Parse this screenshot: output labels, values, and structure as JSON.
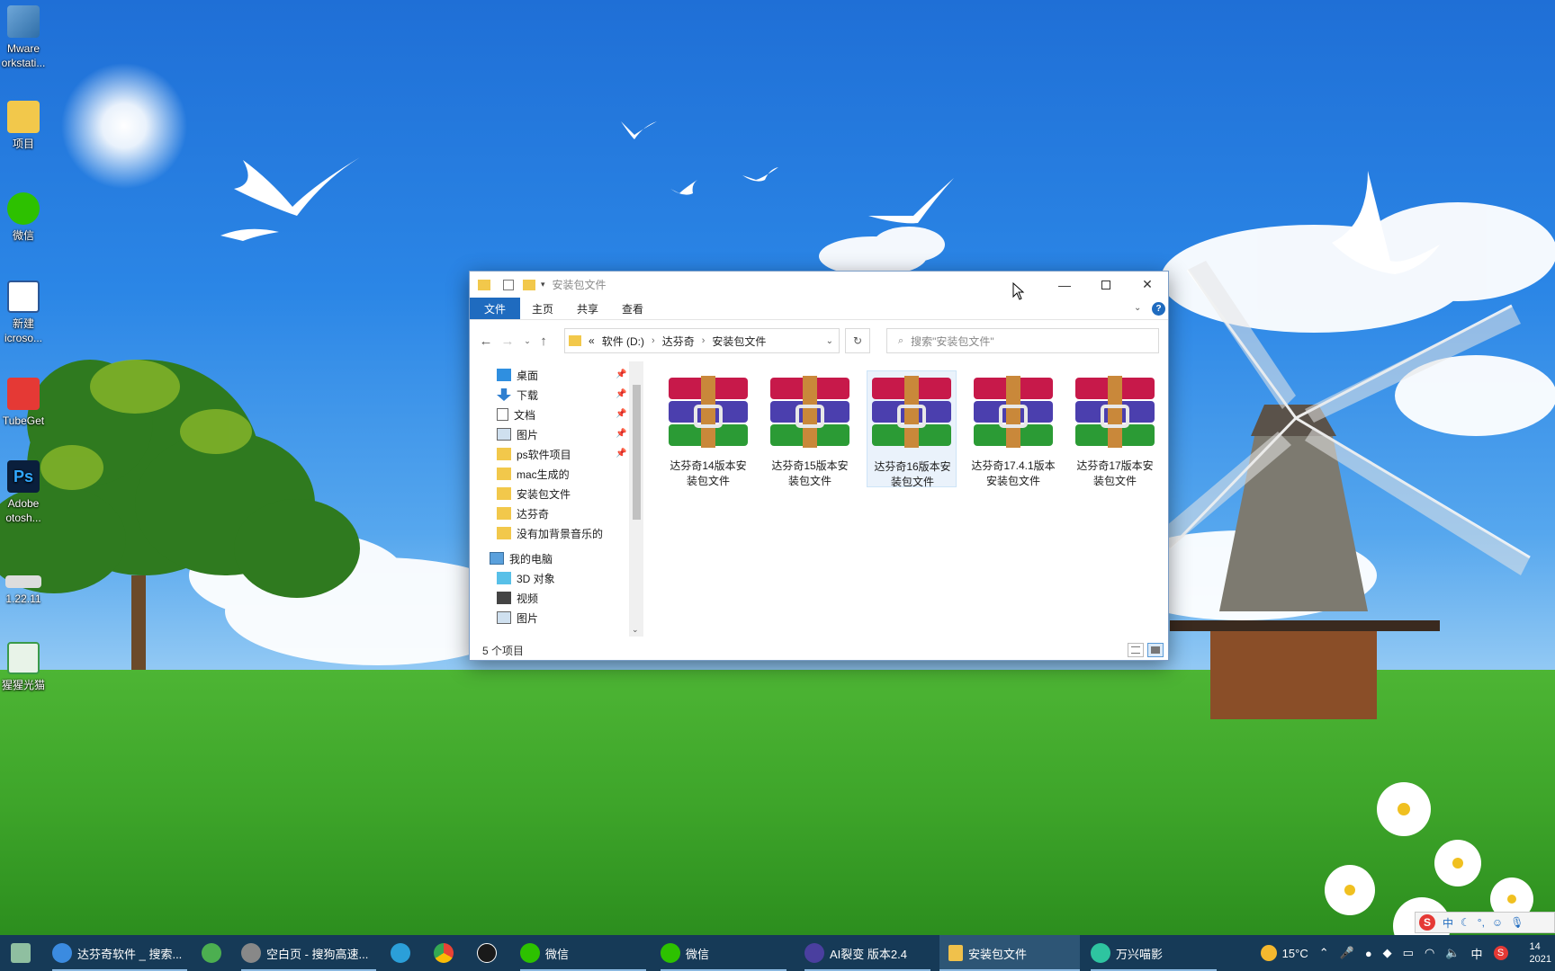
{
  "desktop": {
    "icons": [
      {
        "label": "Mware\norkstati...",
        "icon": "vmware-icon"
      },
      {
        "label": "项目",
        "icon": "folder-icon"
      },
      {
        "label": "微信",
        "icon": "wechat-icon"
      },
      {
        "label": "新建\nicroso...",
        "icon": "word-doc-icon"
      },
      {
        "label": "TubeGet",
        "icon": "tubeget-icon"
      },
      {
        "label": "Adobe\notosh...",
        "icon": "photoshop-icon"
      },
      {
        "label": "1.22.11",
        "icon": "app-icon"
      },
      {
        "label": "猩猩光猫",
        "icon": "app-icon"
      }
    ]
  },
  "explorer": {
    "title": "安装包文件",
    "ribbon_tabs": [
      "文件",
      "主页",
      "共享",
      "查看"
    ],
    "address": {
      "prefix": "«",
      "segments": [
        "软件 (D:)",
        "达芬奇",
        "安装包文件"
      ]
    },
    "search_placeholder": "搜索\"安装包文件\"",
    "nav": {
      "quick_access": [
        {
          "label": "桌面",
          "pinned": true,
          "icon": "desktop-icon"
        },
        {
          "label": "下载",
          "pinned": true,
          "icon": "download-icon"
        },
        {
          "label": "文档",
          "pinned": true,
          "icon": "documents-icon"
        },
        {
          "label": "图片",
          "pinned": true,
          "icon": "pictures-icon"
        },
        {
          "label": "ps软件项目",
          "pinned": true,
          "icon": "folder-icon"
        },
        {
          "label": "mac生成的",
          "pinned": false,
          "icon": "folder-icon"
        },
        {
          "label": "安装包文件",
          "pinned": false,
          "icon": "folder-icon"
        },
        {
          "label": "达芬奇",
          "pinned": false,
          "icon": "folder-icon"
        },
        {
          "label": "没有加背景音乐的",
          "pinned": false,
          "icon": "folder-icon"
        }
      ],
      "this_pc": {
        "label": "我的电脑",
        "icon": "computer-icon"
      },
      "pc_items": [
        {
          "label": "3D 对象",
          "icon": "3d-objects-icon"
        },
        {
          "label": "视频",
          "icon": "videos-icon"
        },
        {
          "label": "图片",
          "icon": "pictures-icon"
        }
      ]
    },
    "files": [
      {
        "name": "达芬奇14版本安装包文件",
        "selected": false
      },
      {
        "name": "达芬奇15版本安装包文件",
        "selected": false
      },
      {
        "name": "达芬奇16版本安装包文件",
        "selected": true
      },
      {
        "name": "达芬奇17.4.1版本安装包文件",
        "selected": false
      },
      {
        "name": "达芬奇17版本安装包文件",
        "selected": false
      }
    ],
    "status": "5 个项目"
  },
  "taskbar": {
    "items": [
      {
        "label": "达芬奇软件 _ 搜索...",
        "icon": "search-browser-icon",
        "color": "#3b8be0"
      },
      {
        "label": "",
        "icon": "app-green-icon",
        "color": "#4caf50"
      },
      {
        "label": "空白页 - 搜狗高速...",
        "icon": "sogou-browser-icon",
        "color": "#888888"
      },
      {
        "label": "",
        "icon": "edge-icon",
        "color": "#2b9fd9"
      },
      {
        "label": "",
        "icon": "chrome-icon",
        "color": "#e94335"
      },
      {
        "label": "",
        "icon": "dell-icon",
        "color": "#1a1a1a"
      },
      {
        "label": "微信",
        "icon": "wechat-icon",
        "color": "#2dc100"
      },
      {
        "label": "微信",
        "icon": "wechat-icon",
        "color": "#2dc100"
      },
      {
        "label": "AI裂变  版本2.4",
        "icon": "ai-app-icon",
        "color": "#4a3f9f"
      },
      {
        "label": "安装包文件",
        "icon": "folder-icon",
        "color": "#f0c14b"
      },
      {
        "label": "万兴喵影",
        "icon": "filmora-icon",
        "color": "#2ec4a0"
      }
    ],
    "tray": {
      "weather": "15°C",
      "ime": "中",
      "clock_time": "14",
      "clock_date": "2021"
    },
    "ime_bar": {
      "label": "中"
    }
  },
  "colors": {
    "accent": "#1f6bbf",
    "taskbar": "#163a57",
    "selection": "#eaf2fb"
  }
}
